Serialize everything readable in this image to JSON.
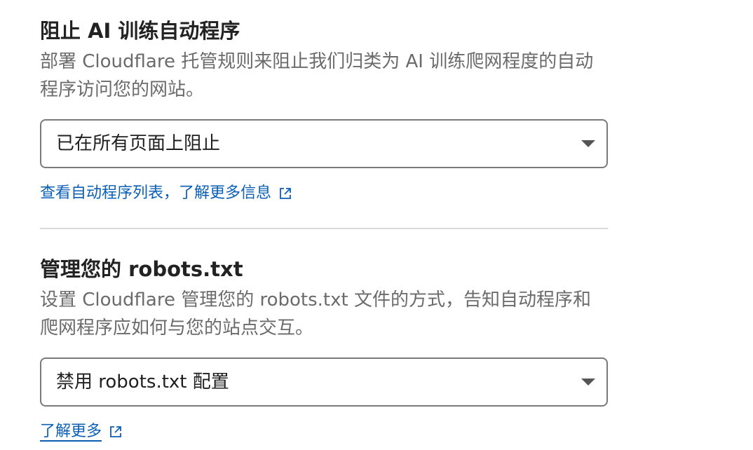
{
  "block_ai": {
    "title": "阻止 AI 训练自动程序",
    "description": "部署 Cloudflare 托管规则来阻止我们归类为 AI 训练爬网程度的自动程序访问您的网站。",
    "select_value": "已在所有页面上阻止",
    "link_label": "查看自动程序列表，了解更多信息"
  },
  "robots": {
    "title": "管理您的 robots.txt",
    "description": "设置 Cloudflare 管理您的 robots.txt 文件的方式，告知自动程序和爬网程序应如何与您的站点交互。",
    "select_value": "禁用 robots.txt 配置",
    "link_label": "了解更多"
  },
  "icons": {
    "caret": "chevron-down-icon",
    "external": "external-link-icon"
  },
  "colors": {
    "link": "#0b5fb5",
    "description": "#6b6b6b",
    "border": "#7a7a7a",
    "divider": "#d9d9d9"
  }
}
